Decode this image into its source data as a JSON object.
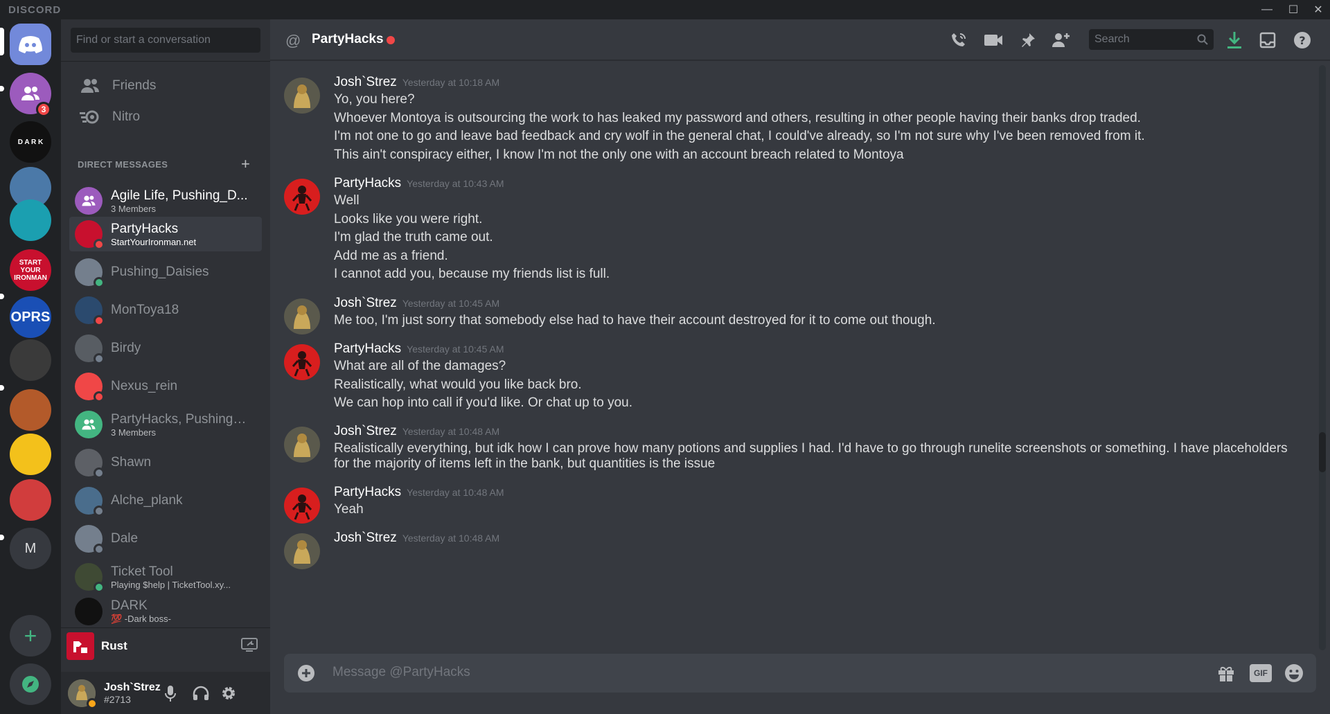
{
  "app": {
    "brand": "DISCORD"
  },
  "window_controls": {
    "minimize": "—",
    "maximize": "☐",
    "close": "✕"
  },
  "servers": [
    {
      "name": "Home",
      "icon": "discord-logo-icon",
      "color": "#7289da",
      "selected": true
    },
    {
      "name": "Group",
      "icon": "group-icon",
      "color": "#9c5bbd",
      "badge": "3"
    },
    {
      "name": "DARK",
      "text": "D A R K",
      "color": "#111111"
    },
    {
      "name": "Panda",
      "color": "#4b79a8"
    },
    {
      "name": "Swirl",
      "color": "#1b9fb0"
    },
    {
      "name": "Start Your Ironman",
      "text": "START YOUR IRONMAN",
      "color": "#c8102e"
    },
    {
      "name": "OPRS",
      "text": "OPRS",
      "color": "#1a4fb5"
    },
    {
      "name": "Dog",
      "color": "#3a3a3a"
    },
    {
      "name": "Anime",
      "color": "#b35a2a"
    },
    {
      "name": "Pancake",
      "color": "#f3c11b"
    },
    {
      "name": "Red Helmet",
      "color": "#d13d3d"
    },
    {
      "name": "M",
      "text": "M",
      "color": "#36393f"
    }
  ],
  "add_server_label": "+",
  "sidebar": {
    "search_placeholder": "Find or start a conversation",
    "nav": [
      {
        "label": "Friends",
        "icon": "friends-icon"
      },
      {
        "label": "Nitro",
        "icon": "nitro-icon"
      }
    ],
    "dm_header": "DIRECT MESSAGES",
    "dm_add": "+",
    "dms": [
      {
        "name": "Agile Life, Pushing_D...",
        "sub": "3 Members",
        "color": "#9c5bbd",
        "status": "",
        "bright": true
      },
      {
        "name": "PartyHacks",
        "sub": "StartYourIronman.net",
        "color": "#c8102e",
        "status": "#f04747",
        "active": true
      },
      {
        "name": "Pushing_Daisies",
        "sub": "",
        "color": "#747f8d",
        "status": "#43b581"
      },
      {
        "name": "MonToya18",
        "sub": "",
        "color": "#2b4a6e",
        "status": "#f04747"
      },
      {
        "name": "Birdy",
        "sub": "",
        "color": "#585d63",
        "status": "#747f8d"
      },
      {
        "name": "Nexus_rein",
        "sub": "",
        "color": "#f04747",
        "status": "#f04747"
      },
      {
        "name": "PartyHacks, Pushing_...",
        "sub": "3 Members",
        "color": "#43b581",
        "status": ""
      },
      {
        "name": "Shawn",
        "sub": "",
        "color": "#5d6066",
        "status": "#747f8d"
      },
      {
        "name": "Alche_plank",
        "sub": "",
        "color": "#4a6d8c",
        "status": "#747f8d"
      },
      {
        "name": "Dale",
        "sub": "",
        "color": "#747f8d",
        "status": "#747f8d"
      },
      {
        "name": "Ticket Tool",
        "sub": "Playing $help | TicketTool.xy...",
        "color": "#3f4a34",
        "status": "#43b581"
      },
      {
        "name": "DARK",
        "sub": "💯 -Dark boss-",
        "color": "#111111",
        "status": ""
      }
    ],
    "voice": {
      "game": "Rust"
    },
    "user": {
      "name": "Josh`Strez",
      "tag": "#2713"
    }
  },
  "channel": {
    "name": "PartyHacks",
    "search_placeholder": "Search"
  },
  "messages": [
    {
      "author": "Josh`Strez",
      "timestamp": "Yesterday at 10:18 AM",
      "avatar": "josh",
      "lines": [
        "Yo, you here?",
        "Whoever Montoya is outsourcing the work to has leaked my password and others, resulting in other people having their banks drop traded.",
        "I'm not one to go and leave bad feedback and cry wolf in the general chat, I could've already, so I'm not sure why I've been removed from it.",
        "This ain't conspiracy either, I know I'm not the only one with an account breach related to Montoya"
      ]
    },
    {
      "author": "PartyHacks",
      "timestamp": "Yesterday at 10:43 AM",
      "avatar": "party",
      "lines": [
        "Well",
        "Looks like you were right.",
        "I'm glad the truth came out.",
        "Add me as a friend.",
        "I cannot add you, because my friends list is full."
      ]
    },
    {
      "author": "Josh`Strez",
      "timestamp": "Yesterday at 10:45 AM",
      "avatar": "josh",
      "lines": [
        "Me too, I'm just sorry that somebody else had to have their account destroyed for it to come out though."
      ]
    },
    {
      "author": "PartyHacks",
      "timestamp": "Yesterday at 10:45 AM",
      "avatar": "party",
      "lines": [
        "What are all of the damages?",
        "Realistically, what would you like back bro.",
        "We can hop into call if you'd like. Or chat up to you."
      ]
    },
    {
      "author": "Josh`Strez",
      "timestamp": "Yesterday at 10:48 AM",
      "avatar": "josh",
      "lines": [
        "Realistically everything, but idk how I can prove how many potions and supplies I had. I'd have to go through runelite screenshots or something. I have placeholders",
        "for the majority of items left in the bank, but quantities is the issue"
      ]
    },
    {
      "author": "PartyHacks",
      "timestamp": "Yesterday at 10:48 AM",
      "avatar": "party",
      "lines": [
        "Yeah"
      ]
    },
    {
      "author": "Josh`Strez",
      "timestamp": "Yesterday at 10:48 AM",
      "avatar": "josh",
      "lines": []
    }
  ],
  "composer": {
    "placeholder": "Message @PartyHacks",
    "gif_label": "GIF"
  }
}
